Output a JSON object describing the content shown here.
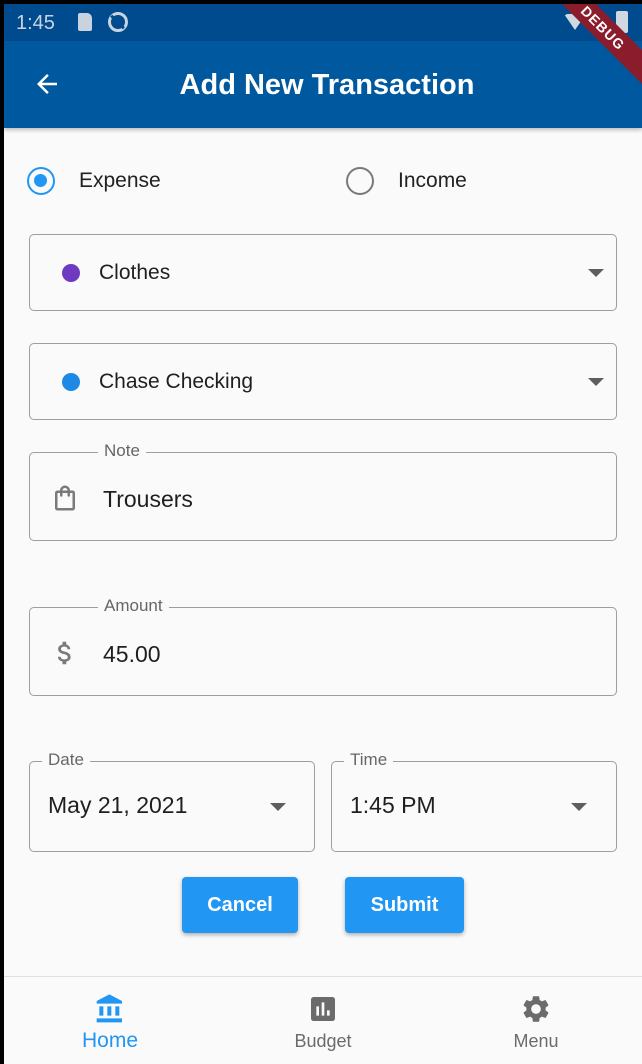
{
  "status_bar": {
    "time": "1:45"
  },
  "app_bar": {
    "title": "Add New Transaction"
  },
  "debug_banner": "DEBUG",
  "type_options": [
    {
      "label": "Expense",
      "selected": true
    },
    {
      "label": "Income",
      "selected": false
    }
  ],
  "category": {
    "label": "Clothes",
    "color": "#6f3ac0"
  },
  "account": {
    "label": "Chase Checking",
    "color": "#1e88e5"
  },
  "note": {
    "label": "Note",
    "value": "Trousers",
    "icon": "shopping-bag-icon"
  },
  "amount": {
    "label": "Amount",
    "value": "45.00",
    "icon": "dollar-icon"
  },
  "date": {
    "label": "Date",
    "value": "May 21, 2021"
  },
  "time": {
    "label": "Time",
    "value": "1:45 PM"
  },
  "buttons": {
    "cancel": "Cancel",
    "submit": "Submit"
  },
  "bottom_nav": [
    {
      "label": "Home",
      "icon": "bank-icon",
      "active": true
    },
    {
      "label": "Budget",
      "icon": "bar-chart-icon",
      "active": false
    },
    {
      "label": "Menu",
      "icon": "gear-icon",
      "active": false
    }
  ],
  "colors": {
    "primary": "#2196f3",
    "app_bar": "#00599e",
    "status_bar": "#004b8d"
  }
}
